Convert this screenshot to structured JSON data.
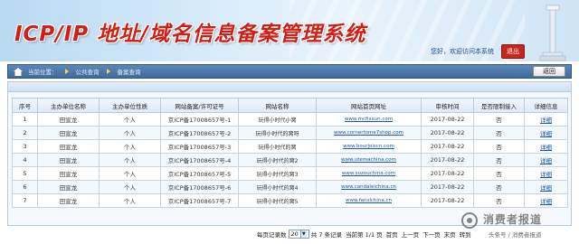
{
  "app": {
    "title": "ICP/IP 地址/域名信息备案管理系统",
    "welcome": "您好，欢迎访问本系统",
    "exit_label": "退出"
  },
  "breadcrumb": {
    "label": "当前位置：",
    "path1": "公共查询",
    "path2": "备案查询",
    "back_label": "返回"
  },
  "table": {
    "headers": [
      "序号",
      "主办单位名称",
      "主办单位性质",
      "网站备案/许可证号",
      "网站名称",
      "网站首页网址",
      "审核时间",
      "是否限制接入",
      "详细信息"
    ],
    "rows": [
      [
        "1",
        "田宣龙",
        "个人",
        "京ICP备17008657号-1",
        "玩得小时代小窝",
        "www.mcfixsun.com",
        "2017-08-22",
        "否",
        "详细"
      ],
      [
        "2",
        "田宣龙",
        "个人",
        "京ICP备17008657号-2",
        "玩得小时代的窝呀",
        "www.cornertome7shop.com",
        "2017-08-22",
        "否",
        "详细"
      ],
      [
        "3",
        "田宣龙",
        "个人",
        "京ICP备17008657号-3",
        "玩得小时代的窝",
        "www.bourjoiscn.com",
        "2017-08-22",
        "否",
        "详细"
      ],
      [
        "4",
        "田宣龙",
        "个人",
        "京ICP备17008657号-4",
        "玩得小时代的窝2",
        "www.utemachina.com",
        "2017-08-22",
        "否",
        "详细"
      ],
      [
        "5",
        "田宣龙",
        "个人",
        "京ICP备17008657号-5",
        "玩得小时代的窝3",
        "www.suzouchina.com",
        "2017-08-22",
        "否",
        "详细"
      ],
      [
        "6",
        "田宣龙",
        "个人",
        "京ICP备17008657号-6",
        "玩得小时代的窝4",
        "www.candaleichina.cn",
        "2017-08-22",
        "否",
        "详细"
      ],
      [
        "7",
        "田宣龙",
        "个人",
        "京ICP备17008657号-7",
        "玩得小时代的窝5",
        "www.fanslchina.cn",
        "2017-08-22",
        "否",
        "详细"
      ]
    ]
  },
  "pager": {
    "per_page_label": "每页记录数",
    "per_page_value": "20",
    "total": "共 7 条记录",
    "page_info": "当前第 1/1 页",
    "first": "首页",
    "prev": "上一页",
    "next": "下一页",
    "last": "末页",
    "goto": "转到"
  },
  "watermark": {
    "title": "消费者报道",
    "subtitle": "头条号 / 消费者报道"
  },
  "colors": {
    "title_red": "#d21f16",
    "nav_blue": "#3f6aa0",
    "link_blue": "#1a56b0"
  }
}
